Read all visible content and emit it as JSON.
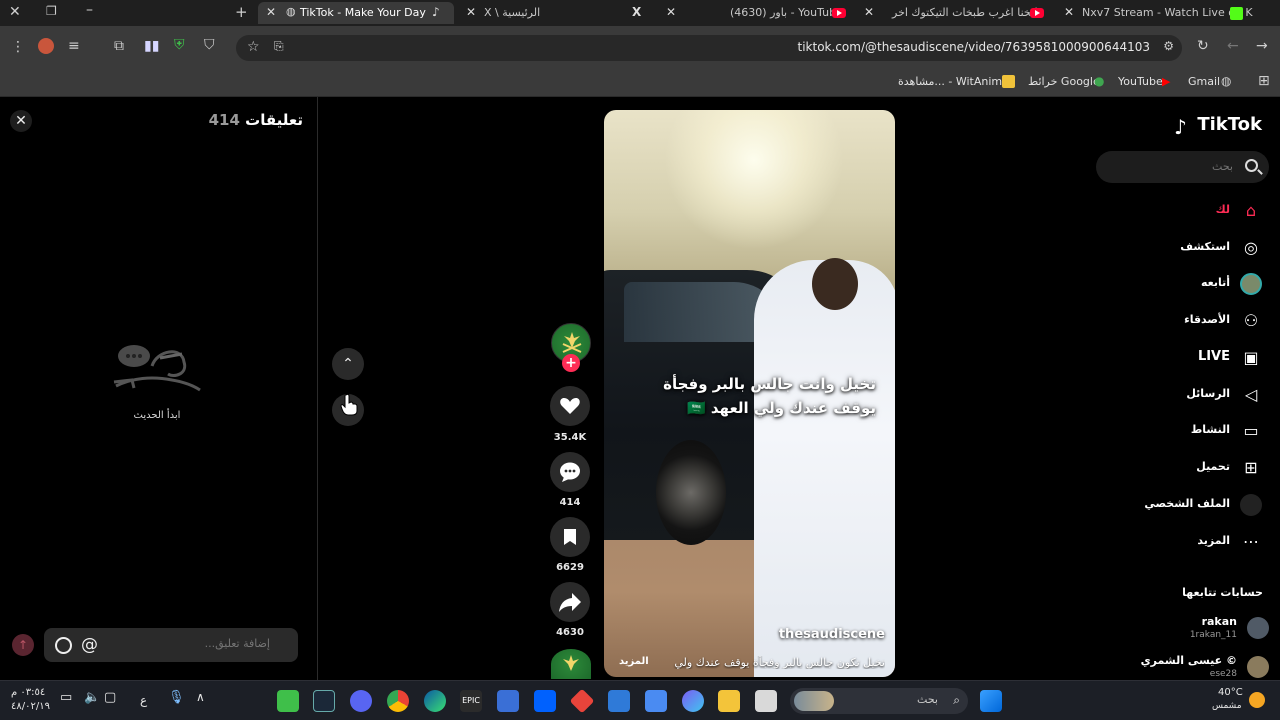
{
  "browser": {
    "tabs": [
      {
        "title": "TikTok - Make Your Day",
        "active": true
      },
      {
        "title": "X \\ الرئيسية",
        "active": false
      },
      {
        "title": "(4630) باور - YouTube",
        "active": false
      },
      {
        "title": "طبخنا اغرب طبخات التيكتوك اخر",
        "active": false
      },
      {
        "title": "Nxv7 Stream - Watch Live on K",
        "active": false
      }
    ],
    "url": "tiktok.com/@thesaudiscene/video/7639581000900644103",
    "bookmarks": [
      "Gmail",
      "YouTube",
      "خرائط Google",
      "مشاهدة... - WitAnime"
    ]
  },
  "comments": {
    "title": "تعليقات",
    "count": "414",
    "empty_text": "ابدأ الحديث",
    "input_placeholder": "إضافة تعليق..."
  },
  "video": {
    "overlay_line1": "تخيل وانت جالس بالبر وفجأة",
    "overlay_line2": "يوقف عندك ولي العهد 🇸🇦",
    "author": "thesaudiscene",
    "description": "تخيل تكون جالس بالبر وفجأة يوقف عندك ولي",
    "more_label": "المزيد"
  },
  "actions": {
    "likes": "35.4K",
    "comments": "414",
    "saves": "6629",
    "shares": "4630"
  },
  "sidebar": {
    "logo": "TikTok",
    "search_placeholder": "بحث",
    "nav": [
      {
        "label": "لك",
        "icon": "home-icon"
      },
      {
        "label": "استكشف",
        "icon": "compass-icon"
      },
      {
        "label": "أتابعه",
        "icon": "following-icon"
      },
      {
        "label": "الأصدقاء",
        "icon": "friends-icon"
      },
      {
        "label": "LIVE",
        "icon": "live-icon"
      },
      {
        "label": "الرسائل",
        "icon": "messages-icon"
      },
      {
        "label": "النشاط",
        "icon": "activity-icon"
      },
      {
        "label": "تحميل",
        "icon": "upload-icon"
      },
      {
        "label": "الملف الشخصي",
        "icon": "profile-icon"
      },
      {
        "label": "المزيد",
        "icon": "more-icon"
      }
    ],
    "following_heading": "حسابات تتابعها",
    "following": [
      {
        "name": "rakan",
        "handle": "1rakan_11"
      },
      {
        "name": "عيسى الشمري ©",
        "handle": "ese28"
      }
    ]
  },
  "taskbar": {
    "weather_temp": "40°C",
    "weather_desc": "مشمس",
    "search_label": "بحث",
    "time": "٠٣:٥٤ م",
    "date": "٤٨/٠٢/١٩",
    "lang": "ع"
  },
  "colors": {
    "accent": "#fe2c55",
    "bg": "#000000",
    "chrome": "#3a3a3a"
  }
}
